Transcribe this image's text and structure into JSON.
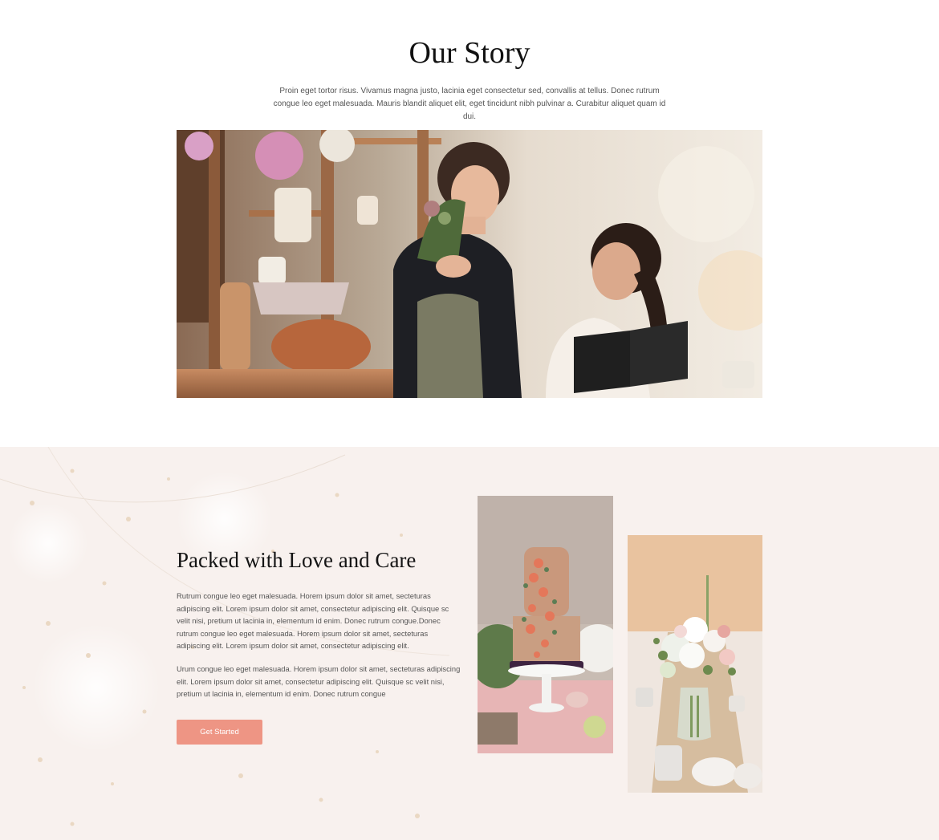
{
  "story": {
    "title": "Our Story",
    "text": "Proin eget tortor risus. Vivamus magna justo, lacinia eget consectetur sed, convallis at tellus. Donec rutrum congue leo eget malesuada. Mauris blandit aliquet elit, eget tincidunt nibh pulvinar a. Curabitur aliquet quam id dui."
  },
  "packed": {
    "title": "Packed with Love and Care",
    "paragraph_1": "Rutrum congue leo eget malesuada. Horem ipsum dolor sit amet, secteturas adipiscing elit. Lorem ipsum dolor sit amet, consectetur adipiscing elit. Quisque  sc velit nisi, pretium ut lacinia in, elementum id enim. Donec rutrum congue.Donec rutrum congue leo eget malesuada. Horem ipsum dolor sit amet, secteturas adipiscing elit. Lorem ipsum dolor sit amet, consectetur adipiscing elit.",
    "paragraph_2": "Urum congue leo eget malesuada. Horem ipsum dolor sit amet, secteturas adipiscing elit. Lorem ipsum dolor sit amet, consectetur adipiscing elit. Quisque  sc velit nisi, pretium ut lacinia in, elementum id enim. Donec rutrum congue",
    "cta_label": "Get Started"
  },
  "images": {
    "story_photo": "florists-in-flower-shop-photo",
    "cake_photo": "floral-decorated-cake-photo",
    "flower_photo": "flower-vase-table-photo"
  },
  "colors": {
    "accent": "#ee9584",
    "section_background": "#f8f2f0",
    "heading": "#111111",
    "body_text": "#555555"
  }
}
